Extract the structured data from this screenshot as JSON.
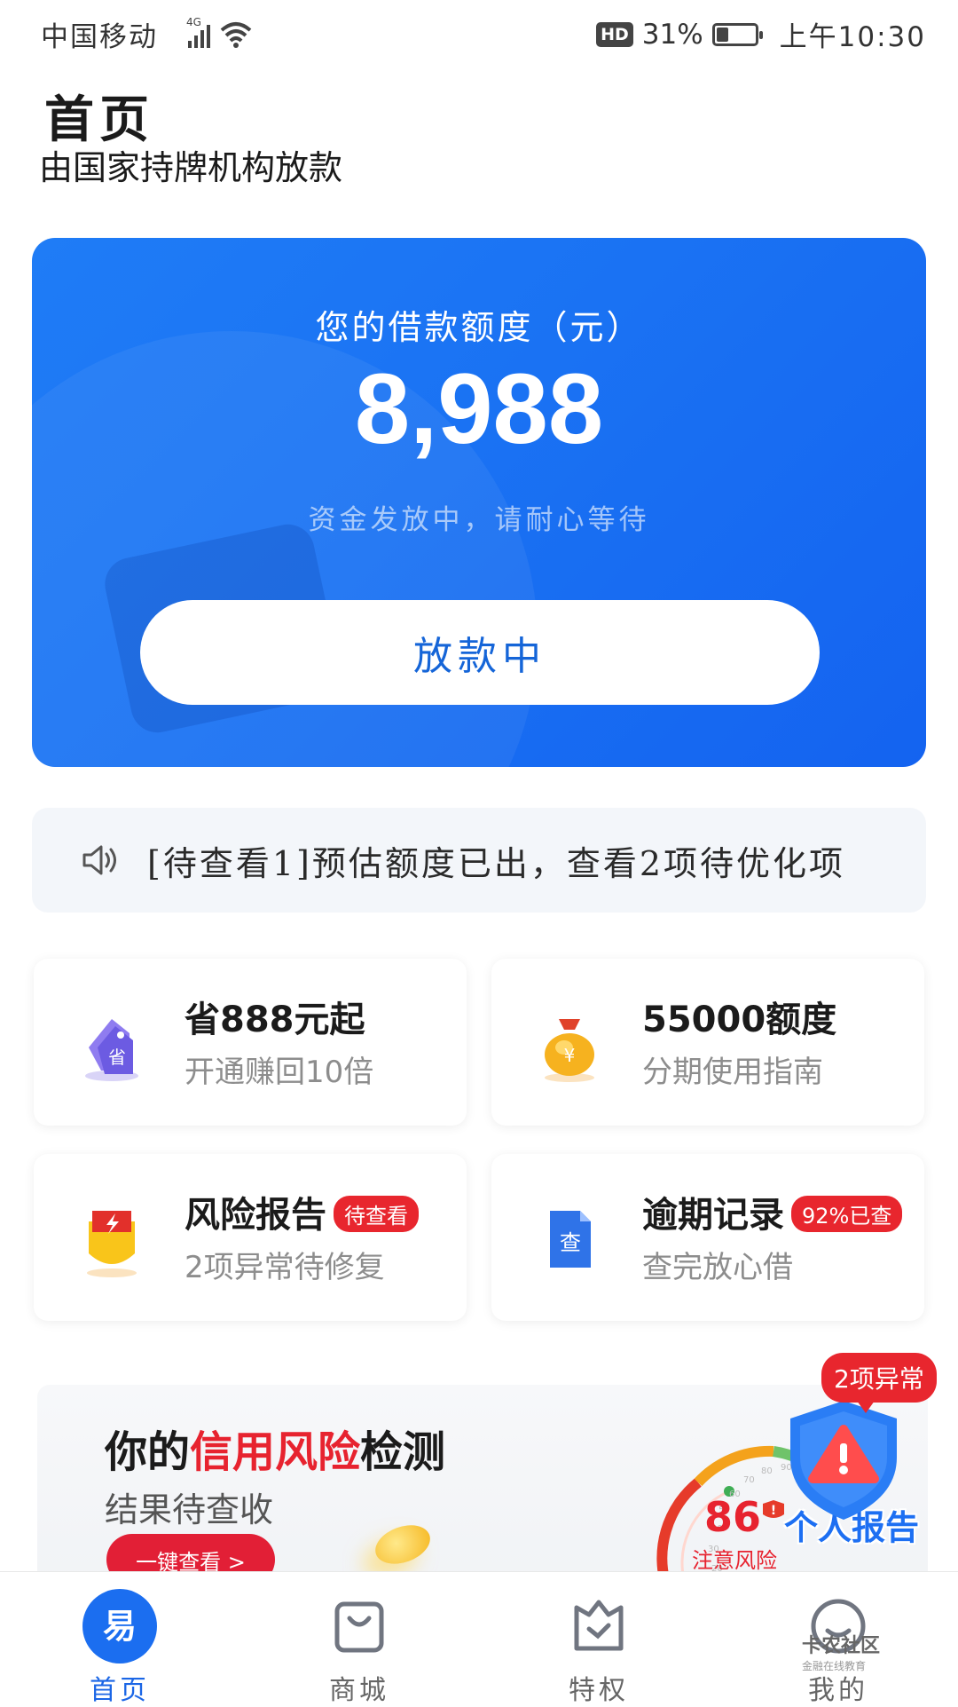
{
  "status_bar": {
    "carrier": "中国移动",
    "network": "4G",
    "hd": "HD",
    "battery": "31%",
    "battery_level": 0.31,
    "time": "上午10:30"
  },
  "header": {
    "title": "首页",
    "subtitle": "由国家持牌机构放款"
  },
  "credit_card": {
    "label": "您的借款额度（元）",
    "amount": "8,988",
    "status": "资金发放中，请耐心等待",
    "button": "放款中"
  },
  "notice": {
    "text": "[待查看1]预估额度已出，查看2项待优化项"
  },
  "tiles": [
    {
      "title": "省888元起",
      "desc": "开通赚回10倍",
      "icon": "discount-tag-icon",
      "icon_text": "省"
    },
    {
      "title": "55000额度",
      "desc": "分期使用指南",
      "icon": "money-bag-icon",
      "icon_text": "¥"
    },
    {
      "title": "风险报告",
      "badge": "待查看",
      "desc": "2项异常待修复",
      "icon": "lightning-shield-icon"
    },
    {
      "title": "逾期记录",
      "badge": "92%已查",
      "desc": "查完放心借",
      "icon": "document-search-icon",
      "icon_text": "查"
    }
  ],
  "risk_banner": {
    "title_prefix": "你的",
    "title_highlight": "信用风险",
    "title_suffix": "检测",
    "subtitle": "结果待查收",
    "button": "一键查看 >",
    "score": "86",
    "score_label": "注意风险",
    "report_label": "个人报告",
    "alert": "2项异常",
    "gauge_ticks": [
      "20",
      "30",
      "40",
      "50",
      "60",
      "70",
      "80",
      "90",
      "100",
      "40"
    ]
  },
  "bottom_nav": [
    {
      "label": "首页",
      "icon": "home-logo-icon",
      "icon_text": "易",
      "active": true
    },
    {
      "label": "商城",
      "icon": "shopping-bag-icon",
      "active": false
    },
    {
      "label": "特权",
      "icon": "privilege-crown-icon",
      "active": false
    },
    {
      "label": "我的",
      "icon": "profile-smile-icon",
      "active": false
    }
  ],
  "watermark": {
    "name": "卡农社区",
    "tagline": "金融在线教育"
  },
  "colors": {
    "primary_blue": "#1a72f3",
    "accent_red": "#e8262e"
  }
}
